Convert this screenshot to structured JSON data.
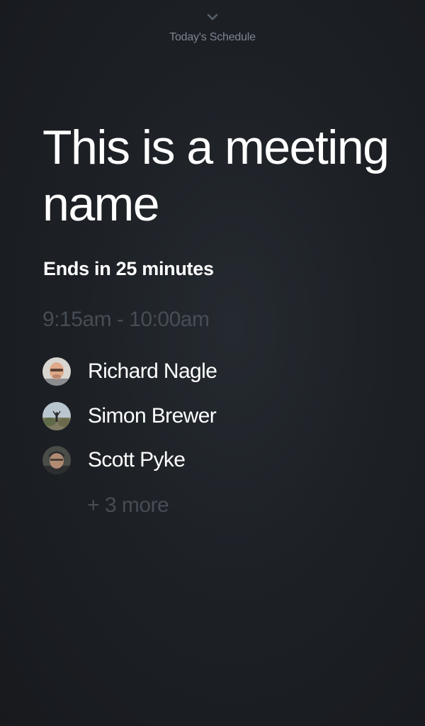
{
  "header": {
    "chevron_icon": "chevron-down-icon",
    "label": "Today's Schedule"
  },
  "meeting": {
    "title": "This is a meeting name",
    "ends_in": "Ends in 25 minutes",
    "time_range": "9:15am - 10:00am"
  },
  "attendees": [
    {
      "name": "Richard Nagle",
      "avatar": "avatar-photo"
    },
    {
      "name": "Simon Brewer",
      "avatar": "avatar-photo"
    },
    {
      "name": "Scott Pyke",
      "avatar": "avatar-photo"
    }
  ],
  "more_label": "+ 3 more",
  "colors": {
    "background": "#1d2126",
    "primary_text": "#ffffff",
    "muted_text": "#474d55",
    "nav_text": "#7e8590"
  }
}
